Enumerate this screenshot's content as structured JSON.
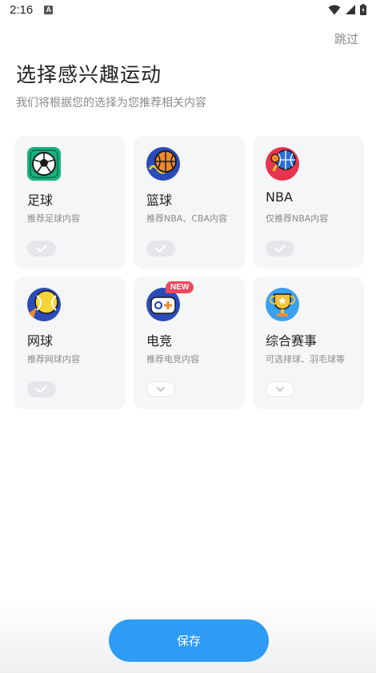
{
  "status_bar": {
    "time": "2:16",
    "notification_icon": "A"
  },
  "header": {
    "skip_label": "跳过",
    "title": "选择感兴趣运动",
    "subtitle": "我们将根据您的选择为您推荐相关内容"
  },
  "sports": [
    {
      "name": "足球",
      "desc": "推荐足球内容",
      "icon": "soccer-ball-icon",
      "state": "checked"
    },
    {
      "name": "篮球",
      "desc": "推荐NBA、CBA内容",
      "icon": "basketball-icon",
      "state": "checked"
    },
    {
      "name": "NBA",
      "desc": "仅推荐NBA内容",
      "icon": "nba-icon",
      "state": "checked"
    },
    {
      "name": "网球",
      "desc": "推荐网球内容",
      "icon": "tennis-ball-icon",
      "state": "checked"
    },
    {
      "name": "电竞",
      "desc": "推荐电竞内容",
      "icon": "gamepad-icon",
      "state": "expand",
      "badge": "NEW"
    },
    {
      "name": "综合赛事",
      "desc": "可选排球、羽毛球等",
      "icon": "trophy-icon",
      "state": "expand"
    }
  ],
  "footer": {
    "save_label": "保存"
  },
  "colors": {
    "accent": "#2e9bf5",
    "badge": "#f0485d",
    "card_bg": "#f5f6f8"
  }
}
